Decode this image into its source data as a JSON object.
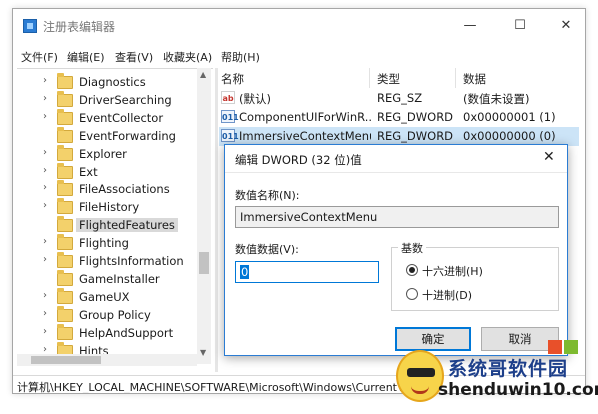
{
  "window": {
    "title": "注册表编辑器",
    "minimize_glyph": "—",
    "maximize_glyph": "☐",
    "close_glyph": "✕"
  },
  "menu": [
    "文件(F)",
    "编辑(E)",
    "查看(V)",
    "收藏夹(A)",
    "帮助(H)"
  ],
  "tree": {
    "items": [
      {
        "label": "Diagnostics",
        "has_children": true
      },
      {
        "label": "DriverSearching",
        "has_children": true
      },
      {
        "label": "EventCollector",
        "has_children": true
      },
      {
        "label": "EventForwarding",
        "has_children": false
      },
      {
        "label": "Explorer",
        "has_children": true
      },
      {
        "label": "Ext",
        "has_children": true
      },
      {
        "label": "FileAssociations",
        "has_children": true
      },
      {
        "label": "FileHistory",
        "has_children": true
      },
      {
        "label": "FlightedFeatures",
        "has_children": false,
        "selected": true
      },
      {
        "label": "Flighting",
        "has_children": true
      },
      {
        "label": "FlightsInformation",
        "has_children": true
      },
      {
        "label": "GameInstaller",
        "has_children": false
      },
      {
        "label": "GameUX",
        "has_children": true
      },
      {
        "label": "Group Policy",
        "has_children": true
      },
      {
        "label": "HelpAndSupport",
        "has_children": true
      },
      {
        "label": "Hints",
        "has_children": true
      }
    ]
  },
  "list": {
    "columns": [
      "名称",
      "类型",
      "数据"
    ],
    "rows": [
      {
        "icon": "string-value-icon",
        "icon_text": "ab",
        "name": "(默认)",
        "type": "REG_SZ",
        "data": "(数值未设置)"
      },
      {
        "icon": "dword-value-icon",
        "icon_text": "011",
        "name": "ComponentUIForWinR...",
        "type": "REG_DWORD",
        "data": "0x00000001 (1)"
      },
      {
        "icon": "dword-value-icon",
        "icon_text": "011",
        "name": "ImmersiveContextMenu",
        "type": "REG_DWORD",
        "data": "0x00000000 (0)",
        "highlighted": true
      }
    ]
  },
  "status": {
    "path": "计算机\\HKEY_LOCAL_MACHINE\\SOFTWARE\\Microsoft\\Windows\\CurrentV"
  },
  "dialog": {
    "title": "编辑 DWORD (32 位)值",
    "close_glyph": "✕",
    "name_label": "数值名称(N):",
    "name_value": "ImmersiveContextMenu",
    "data_label": "数值数据(V):",
    "data_value": "0",
    "base_label": "基数",
    "radio_hex": "十六进制(H)",
    "radio_dec": "十进制(D)",
    "selected_base": "hex",
    "ok_label": "确定",
    "cancel_label": "取消"
  },
  "watermark": {
    "text_cn": "系统哥软件园",
    "text_en": "shenduwin10.com",
    "colors": [
      "#e8502a",
      "#7dba2f"
    ]
  },
  "colors": {
    "accent": "#0078d7",
    "selection": "#cce4f7",
    "folder": "#f3d16b"
  }
}
